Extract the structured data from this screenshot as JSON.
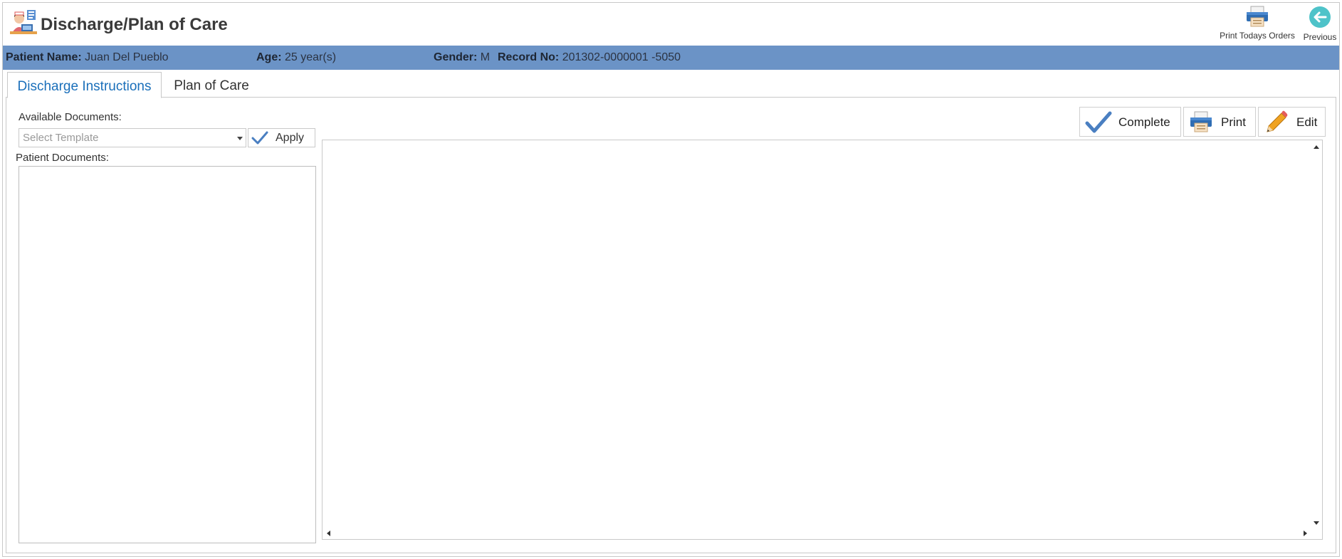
{
  "window": {
    "title": "Discharge/Plan of Care",
    "app_icon": "nurse-at-desk-icon"
  },
  "header_actions": {
    "print_orders_label": "Print Todays Orders",
    "print_orders_icon": "printer-icon",
    "previous_label": "Previous",
    "previous_icon": "arrow-left-circle-icon"
  },
  "patient": {
    "name_label": "Patient Name:",
    "name": "Juan Del Pueblo",
    "age_label": "Age:",
    "age": "25 year(s)",
    "gender_label": "Gender:",
    "gender": "M",
    "record_label": "Record No:",
    "record": "201302-0000001 -5050"
  },
  "tabs": [
    {
      "label": "Discharge Instructions",
      "active": true
    },
    {
      "label": "Plan of Care",
      "active": false
    }
  ],
  "left_panel": {
    "available_label": "Available Documents:",
    "template_placeholder": "Select Template",
    "apply_label": "Apply",
    "patient_docs_label": "Patient Documents:",
    "patient_docs": []
  },
  "toolbar": {
    "complete_label": "Complete",
    "print_label": "Print",
    "edit_label": "Edit"
  },
  "colors": {
    "patient_bar": "#6b93c6",
    "active_tab_text": "#1a6fba",
    "check_blue": "#4a7fc1",
    "previous_teal": "#4ec3c9",
    "pencil_orange": "#f0a322"
  }
}
